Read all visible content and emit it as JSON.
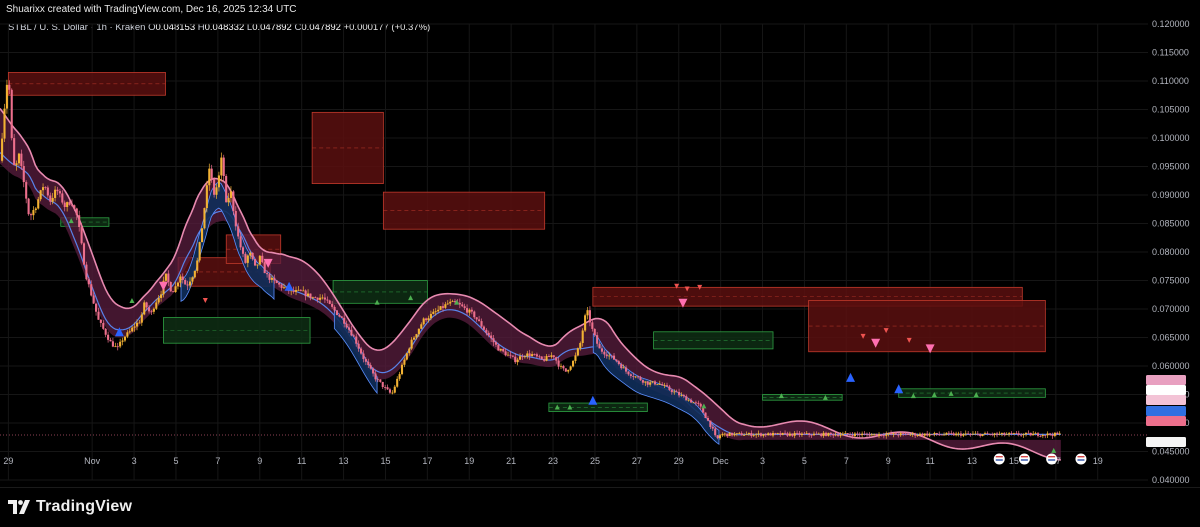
{
  "header": {
    "credit": "Shuarixx created with TradingView.com, Dec 16, 2025 12:34 UTC"
  },
  "legend": {
    "symbol": "STBL / U. S. Dollar · 1h · Kraken",
    "open_label": "O",
    "open": "0.048153",
    "high_label": "H",
    "high": "0.048332",
    "low_label": "L",
    "low": "0.047892",
    "close_label": "C",
    "close": "0.047892",
    "change": "+0.000177 (+0.37%)"
  },
  "footer": {
    "brand": "TradingView",
    "brand_icon": "tradingview-logo-icon"
  },
  "colors": {
    "background": "#000000",
    "grid": "#161616",
    "candle_up": "#f2b233",
    "candle_down": "#ec6f8c",
    "upper_band": "#e88ab0",
    "band_fill_bear": "#5a1d3f",
    "band_fill_bull": "#0f2e5a",
    "ma_line": "#5b8fff",
    "supply_zone": "#5a0f0f",
    "supply_border": "#c0392b",
    "demand_zone": "#0e2e14",
    "demand_border": "#2ea043",
    "signal_up": "#2962ff",
    "signal_down": "#ff6fb0",
    "small_up": "#4caf50",
    "small_down": "#ef5350"
  },
  "chart_data": {
    "type": "line",
    "series_kind": "candlestick",
    "ylim": [
      0.04,
      0.12
    ],
    "y_ticks": [
      "0.120000",
      "0.115000",
      "0.110000",
      "0.105000",
      "0.100000",
      "0.095000",
      "0.090000",
      "0.085000",
      "0.080000",
      "0.075000",
      "0.070000",
      "0.065000",
      "0.060000",
      "0.055000",
      "0.050000",
      "0.045000",
      "0.040000"
    ],
    "x_ticks": [
      "29",
      "Nov",
      "3",
      "5",
      "7",
      "9",
      "11",
      "13",
      "15",
      "17",
      "19",
      "21",
      "23",
      "25",
      "27",
      "29",
      "Dec",
      "3",
      "5",
      "7",
      "9",
      "11",
      "13",
      "15",
      "17",
      "19"
    ],
    "x_tick_days": [
      -3,
      1,
      3,
      5,
      7,
      9,
      11,
      13,
      15,
      17,
      19,
      21,
      23,
      25,
      27,
      29,
      31,
      33,
      35,
      37,
      39,
      41,
      43,
      45,
      47,
      49
    ],
    "x_range_days": [
      -3.4,
      51.4
    ],
    "price_path": [
      [
        -3.4,
        0.096
      ],
      [
        -3.2,
        0.105
      ],
      [
        -3.0,
        0.112
      ],
      [
        -2.85,
        0.1
      ],
      [
        -2.7,
        0.094
      ],
      [
        -2.5,
        0.097
      ],
      [
        -2.3,
        0.093
      ],
      [
        -2.0,
        0.086
      ],
      [
        -1.7,
        0.088
      ],
      [
        -1.3,
        0.092
      ],
      [
        -1.0,
        0.089
      ],
      [
        -0.7,
        0.091
      ],
      [
        -0.3,
        0.088
      ],
      [
        0.0,
        0.089
      ],
      [
        0.3,
        0.086
      ],
      [
        0.5,
        0.081
      ],
      [
        0.7,
        0.076
      ],
      [
        1.0,
        0.072
      ],
      [
        1.3,
        0.068
      ],
      [
        1.6,
        0.066
      ],
      [
        1.9,
        0.064
      ],
      [
        2.2,
        0.063
      ],
      [
        2.5,
        0.065
      ],
      [
        2.8,
        0.066
      ],
      [
        3.0,
        0.067
      ],
      [
        3.3,
        0.068
      ],
      [
        3.5,
        0.071
      ],
      [
        3.8,
        0.069
      ],
      [
        4.0,
        0.071
      ],
      [
        4.3,
        0.073
      ],
      [
        4.5,
        0.076
      ],
      [
        4.8,
        0.073
      ],
      [
        5.0,
        0.074
      ],
      [
        5.2,
        0.076
      ],
      [
        5.5,
        0.074
      ],
      [
        5.8,
        0.076
      ],
      [
        6.0,
        0.078
      ],
      [
        6.2,
        0.083
      ],
      [
        6.4,
        0.089
      ],
      [
        6.6,
        0.095
      ],
      [
        6.8,
        0.09
      ],
      [
        7.0,
        0.092
      ],
      [
        7.2,
        0.097
      ],
      [
        7.4,
        0.088
      ],
      [
        7.6,
        0.091
      ],
      [
        7.8,
        0.086
      ],
      [
        8.0,
        0.082
      ],
      [
        8.3,
        0.078
      ],
      [
        8.5,
        0.08
      ],
      [
        8.8,
        0.077
      ],
      [
        9.0,
        0.079
      ],
      [
        9.3,
        0.076
      ],
      [
        9.6,
        0.075
      ],
      [
        10.0,
        0.074
      ],
      [
        10.5,
        0.073
      ],
      [
        11.0,
        0.073
      ],
      [
        11.5,
        0.072
      ],
      [
        12.0,
        0.072
      ],
      [
        12.5,
        0.07
      ],
      [
        13.0,
        0.068
      ],
      [
        13.5,
        0.065
      ],
      [
        14.0,
        0.061
      ],
      [
        14.5,
        0.058
      ],
      [
        15.0,
        0.056
      ],
      [
        15.3,
        0.055
      ],
      [
        15.6,
        0.058
      ],
      [
        15.9,
        0.061
      ],
      [
        16.2,
        0.064
      ],
      [
        16.5,
        0.066
      ],
      [
        16.8,
        0.068
      ],
      [
        17.2,
        0.069
      ],
      [
        17.6,
        0.07
      ],
      [
        18.0,
        0.071
      ],
      [
        18.4,
        0.071
      ],
      [
        18.8,
        0.07
      ],
      [
        19.2,
        0.069
      ],
      [
        19.6,
        0.067
      ],
      [
        20.0,
        0.065
      ],
      [
        20.4,
        0.063
      ],
      [
        20.8,
        0.062
      ],
      [
        21.2,
        0.061
      ],
      [
        21.6,
        0.062
      ],
      [
        22.0,
        0.062
      ],
      [
        22.5,
        0.061
      ],
      [
        23.0,
        0.062
      ],
      [
        23.3,
        0.06
      ],
      [
        23.6,
        0.059
      ],
      [
        24.0,
        0.061
      ],
      [
        24.3,
        0.064
      ],
      [
        24.6,
        0.07
      ],
      [
        24.9,
        0.066
      ],
      [
        25.2,
        0.063
      ],
      [
        25.6,
        0.062
      ],
      [
        26.0,
        0.061
      ],
      [
        26.5,
        0.059
      ],
      [
        27.0,
        0.058
      ],
      [
        27.5,
        0.057
      ],
      [
        28.0,
        0.057
      ],
      [
        28.5,
        0.056
      ],
      [
        29.0,
        0.055
      ],
      [
        29.5,
        0.054
      ],
      [
        30.0,
        0.053
      ],
      [
        30.3,
        0.051
      ],
      [
        30.6,
        0.049
      ],
      [
        30.8,
        0.047
      ],
      [
        31.0,
        0.048
      ],
      [
        31.2,
        0.048
      ]
    ],
    "price_path_x_unit": "days from Nov 1"
  }
}
